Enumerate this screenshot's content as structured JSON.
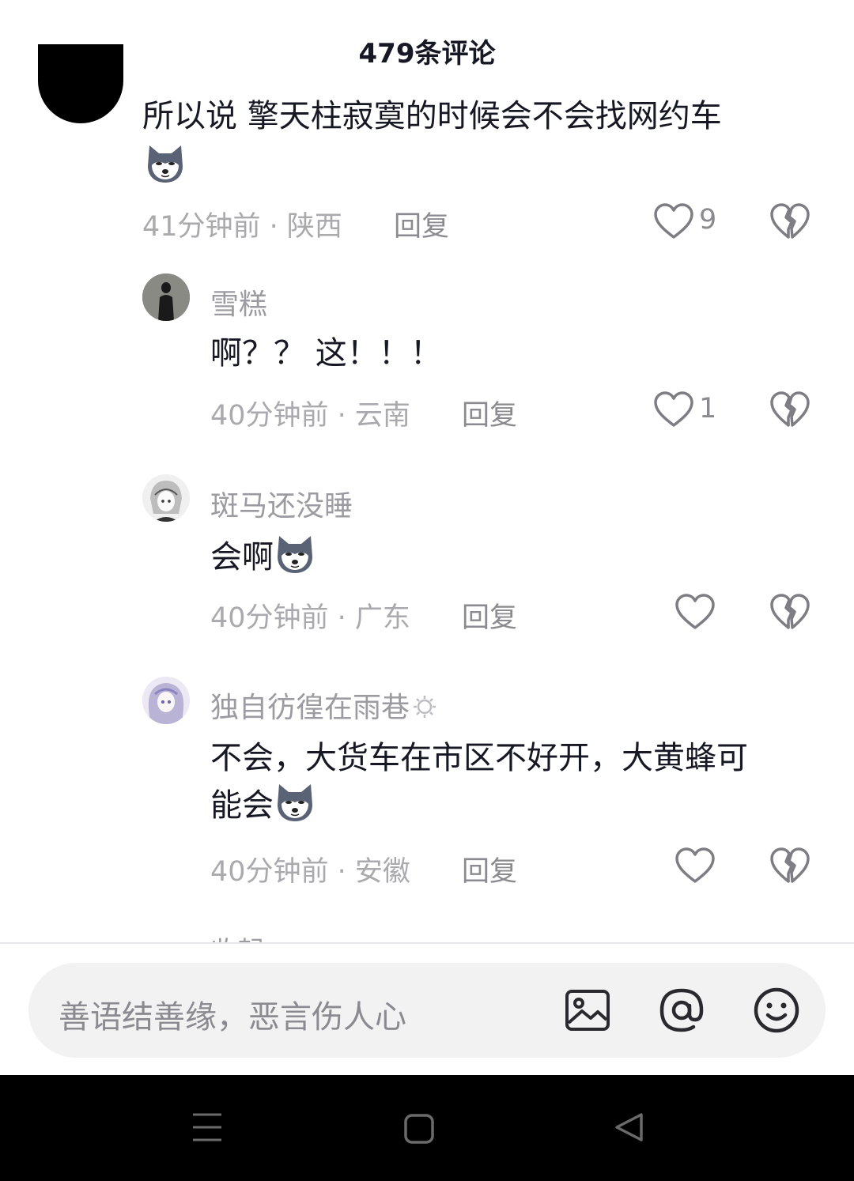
{
  "header": {
    "title": "479条评论"
  },
  "comments": [
    {
      "text": "所以说 擎天柱寂寞的时候会不会找网约车",
      "time_location": "41分钟前 · 陕西",
      "reply_label": "回复",
      "likes": "9",
      "emoji_icon": "husky-dog-emoji"
    },
    {
      "username": "雪糕",
      "text": "啊？？ 这！！！",
      "time_location": "40分钟前 · 云南",
      "reply_label": "回复",
      "likes": "1"
    },
    {
      "username": "斑马还没睡",
      "text": "会啊",
      "time_location": "40分钟前 · 广东",
      "reply_label": "回复",
      "likes": "",
      "emoji_icon": "husky-dog-emoji"
    },
    {
      "username": "独自彷徨在雨巷",
      "text_line1": "不会，大货车在市区不好开，大黄蜂可",
      "text_line2": "能会",
      "time_location": "40分钟前 · 安徽",
      "reply_label": "回复",
      "likes": "",
      "emoji_icon": "husky-dog-emoji"
    }
  ],
  "collapse_label": "收起",
  "input": {
    "placeholder": "善语结善缘，恶言伤人心"
  },
  "icons": {
    "like": "heart-icon",
    "dislike": "broken-heart-icon",
    "image": "image-icon",
    "mention": "at-icon",
    "emoji": "smiley-icon",
    "nav_menu": "menu-icon",
    "nav_home": "square-icon",
    "nav_back": "back-triangle-icon"
  }
}
